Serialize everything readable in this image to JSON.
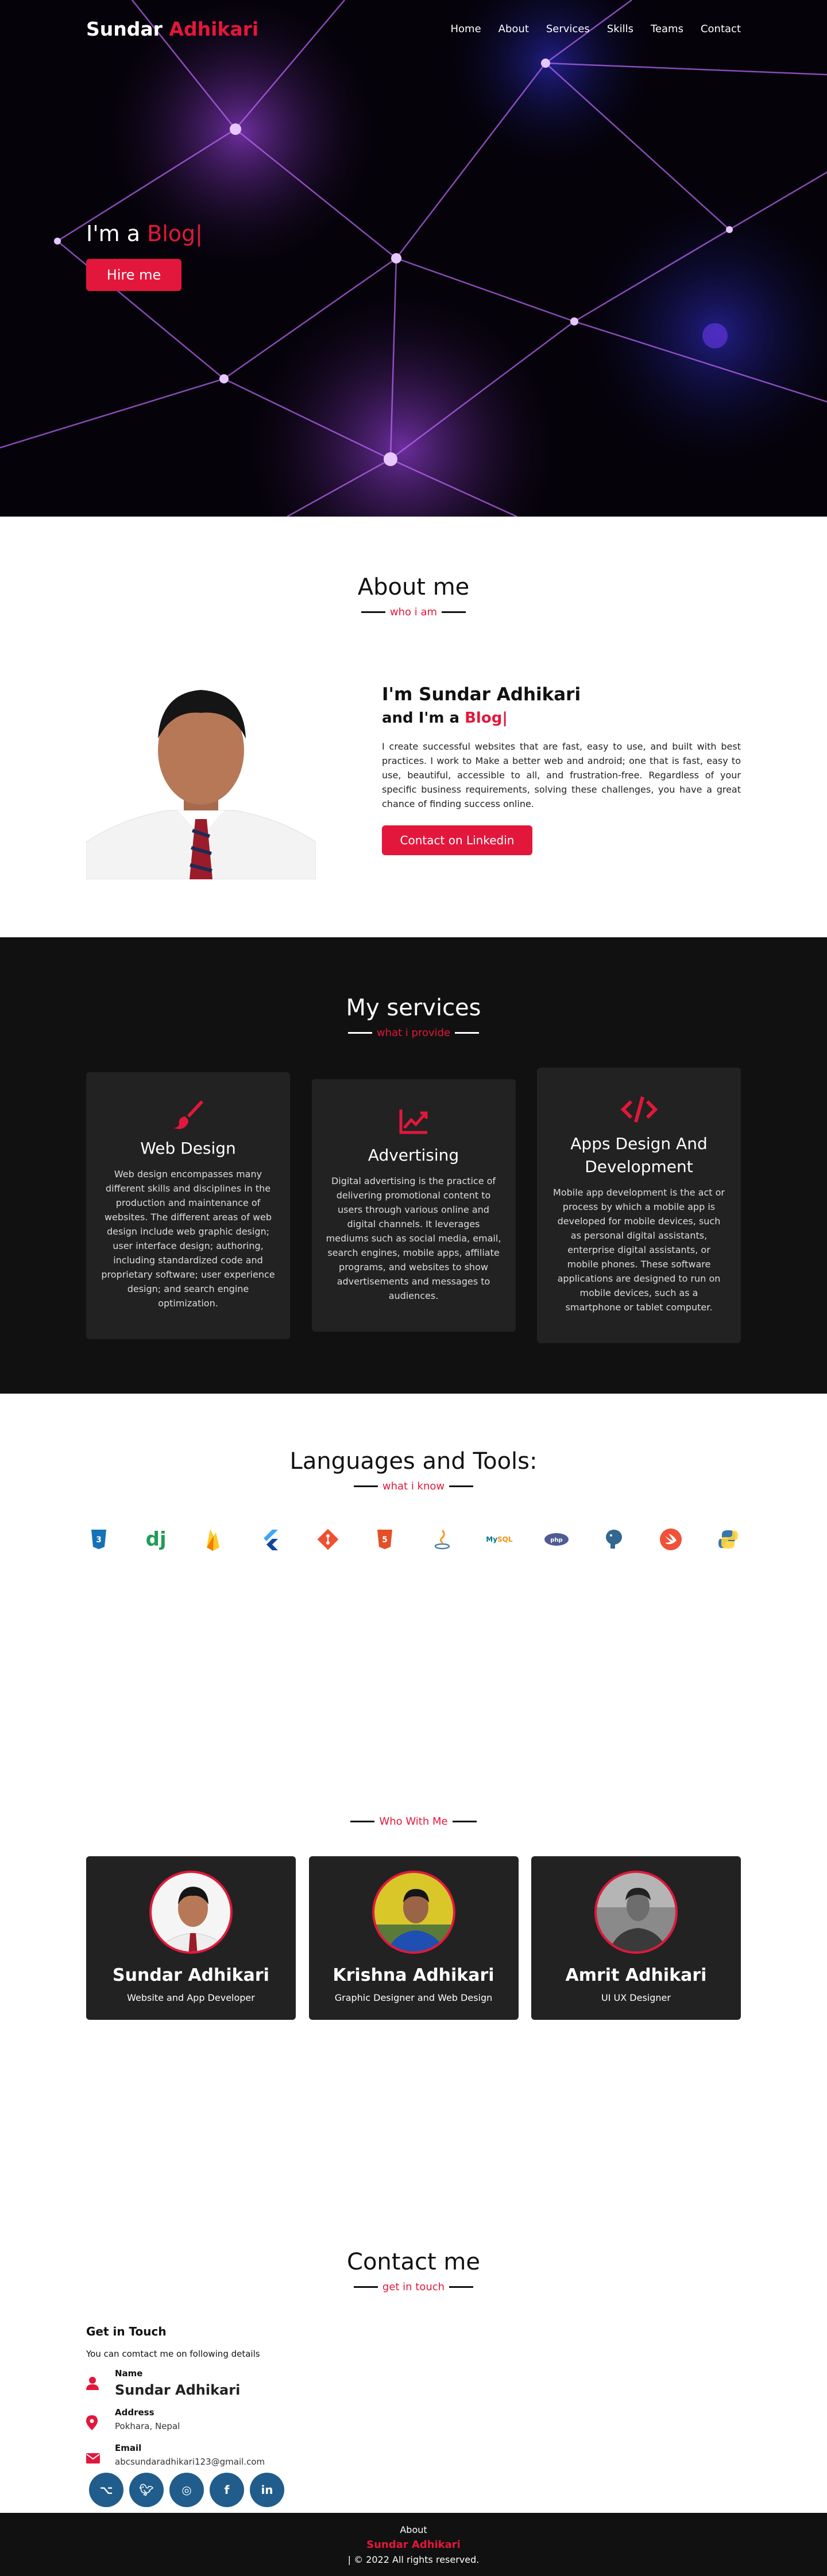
{
  "nav": {
    "logo_first": "Sundar",
    "logo_second": "Adhikari",
    "items": [
      "Home",
      "About",
      "Services",
      "Skills",
      "Teams",
      "Contact"
    ]
  },
  "hero": {
    "prefix": "I'm a",
    "typed": "Blog|",
    "button": "Hire me"
  },
  "about": {
    "title": "About me",
    "subtitle": "who i am",
    "name_line": "I'm Sundar Adhikari",
    "role_prefix": "and I'm a",
    "role_typed": "Blog|",
    "description": "I create successful websites that are fast, easy to use, and built with best practices. I work to Make a better web and android; one that is fast, easy to use, beautiful, accessible to all, and frustration-free. Regardless of your specific business requirements, solving these challenges, you have a great chance of finding success online.",
    "button": "Contact on Linkedin"
  },
  "services": {
    "title": "My services",
    "subtitle": "what i provide",
    "cards": [
      {
        "icon": "paint-brush-icon",
        "title": "Web Design",
        "text": "Web design encompasses many different skills and disciplines in the production and maintenance of websites. The different areas of web design include web graphic design; user interface design; authoring, including standardized code and proprietary software; user experience design; and search engine optimization."
      },
      {
        "icon": "chart-line-icon",
        "title": "Advertising",
        "text": "Digital advertising is the practice of delivering promotional content to users through various online and digital channels. It leverages mediums such as social media, email, search engines, mobile apps, affiliate programs, and websites to show advertisements and messages to audiences."
      },
      {
        "icon": "code-icon",
        "title": "Apps Design And Development",
        "text": "Mobile app development is the act or process by which a mobile app is developed for mobile devices, such as personal digital assistants, enterprise digital assistants, or mobile phones. These software applications are designed to run on mobile devices, such as a smartphone or tablet computer."
      }
    ]
  },
  "skills": {
    "title": "Languages and Tools:",
    "subtitle": "what i know",
    "tools": [
      {
        "name": "css3-icon",
        "color": "#1572b6"
      },
      {
        "name": "django-icon",
        "color": "#1f9d55"
      },
      {
        "name": "firebase-icon",
        "color": "#ffca28"
      },
      {
        "name": "flutter-icon",
        "color": "#42a5f5"
      },
      {
        "name": "git-icon",
        "color": "#f05032"
      },
      {
        "name": "html5-icon",
        "color": "#e34f26"
      },
      {
        "name": "java-icon",
        "color": "#5382a1"
      },
      {
        "name": "mysql-icon",
        "color": "#00758f"
      },
      {
        "name": "php-icon",
        "color": "#4f5b93"
      },
      {
        "name": "postgresql-icon",
        "color": "#336791"
      },
      {
        "name": "swift-icon",
        "color": "#f05138"
      },
      {
        "name": "python-icon",
        "color": "#3776ab"
      }
    ]
  },
  "teams": {
    "subtitle": "Who With Me",
    "members": [
      {
        "name": "Sundar Adhikari",
        "role": "Website and App Developer"
      },
      {
        "name": "Krishna Adhikari",
        "role": "Graphic Designer and Web Design"
      },
      {
        "name": "Amrit Adhikari",
        "role": "UI UX Designer"
      }
    ]
  },
  "contact": {
    "title": "Contact me",
    "subtitle": "get in touch",
    "heading": "Get in Touch",
    "intro": "You can comtact me on following details",
    "name_label": "Name",
    "name_value": "Sundar Adhikari",
    "address_label": "Address",
    "address_value": "Pokhara, Nepal",
    "email_label": "Email",
    "email_value": "abcsundaradhikari123@gmail.com",
    "socials": [
      "github-icon",
      "twitter-icon",
      "instagram-icon",
      "facebook-icon",
      "linkedin-icon"
    ]
  },
  "footer": {
    "about": "About",
    "name": "Sundar Adhikari",
    "copy": "| © 2022 All rights reserved."
  },
  "colors": {
    "accent": "#e3173b",
    "dark": "#111111",
    "card": "#222222",
    "social": "#205d8c"
  }
}
